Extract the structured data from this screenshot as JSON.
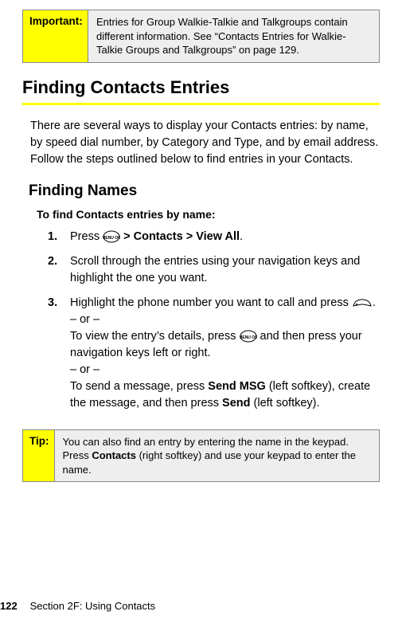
{
  "important": {
    "label": "Important:",
    "text_before": "Entries for Group Walkie-Talkie and Talkgroups contain different information. See “Contacts Entries for Walkie-Talkie Groups and Talkgroups” on page 129."
  },
  "heading": "Finding Contacts Entries",
  "intro": "There are several ways to display your Contacts entries: by name, by speed dial number, by Category and Type, and by email address. Follow the steps outlined below to find entries in your Contacts.",
  "subheading": "Finding Names",
  "lead": "To find Contacts entries by name:",
  "steps": {
    "s1": {
      "num": "1.",
      "a": "Press ",
      "b": " > ",
      "c": "Contacts",
      "d": " > ",
      "e": "View All",
      "f": "."
    },
    "s2": {
      "num": "2.",
      "text": "Scroll through the entries using your navigation keys and highlight the one you want."
    },
    "s3": {
      "num": "3.",
      "a": "Highlight the phone number you want to call and press ",
      "b": ".",
      "or": "– or –",
      "c1": "To view the entry’s details, press ",
      "c2": " and then press your navigation keys left or right.",
      "d1": "To send a message, press ",
      "d1b": "Send MSG",
      "d2": " (left softkey), create the message, and then press ",
      "d2b": "Send",
      "d3": " (left softkey)."
    }
  },
  "tip": {
    "label": "Tip:",
    "t1": "You can also find an entry by entering the name in the keypad. Press ",
    "t1b": "Contacts",
    "t2": " (right softkey) and use your keypad to enter the name."
  },
  "footer": {
    "page_number": "122",
    "section": "Section 2F: Using Contacts"
  }
}
